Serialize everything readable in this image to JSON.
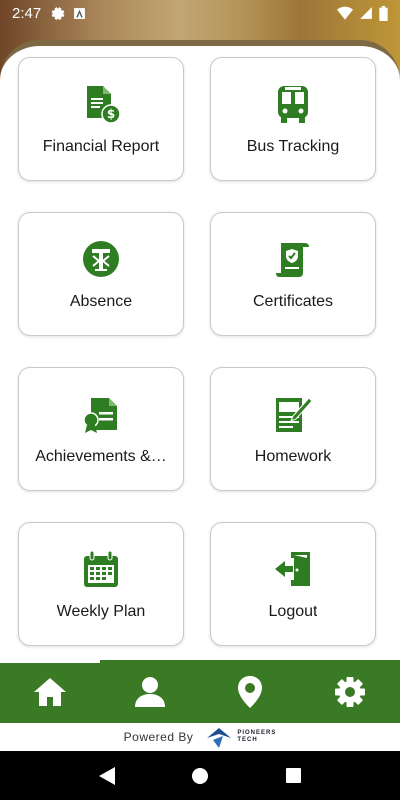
{
  "status_bar": {
    "time": "2:47"
  },
  "tiles": [
    {
      "label": "Financial Report",
      "icon": "financial-report-icon"
    },
    {
      "label": "Bus Tracking",
      "icon": "bus-icon"
    },
    {
      "label": "Absence",
      "icon": "absence-icon"
    },
    {
      "label": "Certificates",
      "icon": "certificate-icon"
    },
    {
      "label": "Achievements &…",
      "icon": "achievements-icon"
    },
    {
      "label": "Homework",
      "icon": "homework-icon"
    },
    {
      "label": "Weekly Plan",
      "icon": "calendar-icon"
    },
    {
      "label": "Logout",
      "icon": "logout-icon"
    }
  ],
  "bottom_nav": [
    "home-icon",
    "profile-icon",
    "location-icon",
    "settings-icon"
  ],
  "footer": {
    "powered_by": "Powered By",
    "brand_line1": "PIONEERS",
    "brand_line2": "TECH"
  },
  "colors": {
    "primary_green": "#3b7a25",
    "icon_green": "#2f7d22",
    "border": "#c9c9c9"
  }
}
